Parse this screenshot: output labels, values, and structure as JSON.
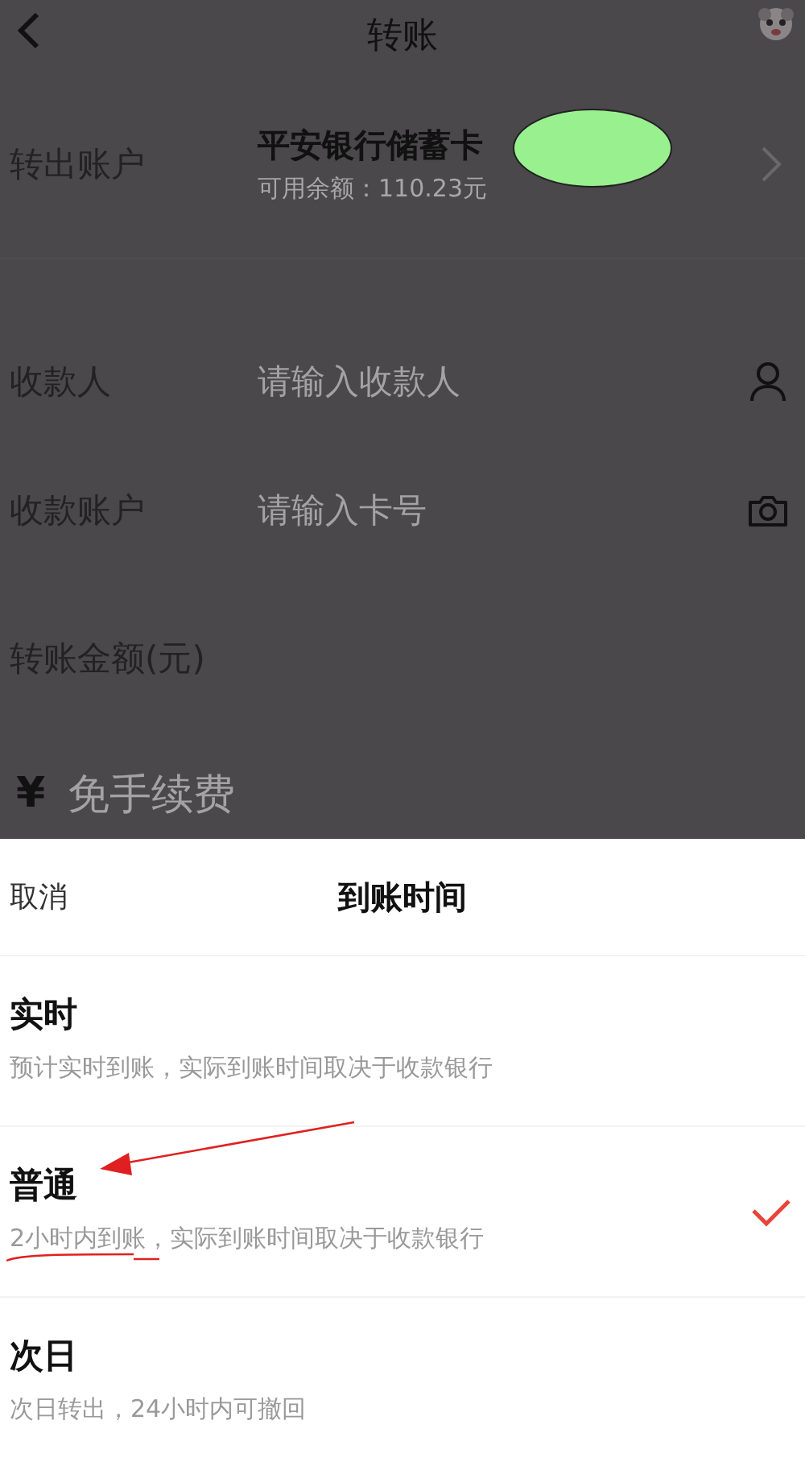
{
  "header": {
    "title": "转账"
  },
  "from_account": {
    "label": "转出账户",
    "card_name": "平安银行储蓄卡",
    "balance": "可用余额：110.23元"
  },
  "fields": [
    {
      "label": "收款人",
      "placeholder": "请输入收款人",
      "kind": "person"
    },
    {
      "label": "收款账户",
      "placeholder": "请输入卡号",
      "kind": "camera"
    }
  ],
  "amount": {
    "label": "转账金额(元)",
    "currency": "¥",
    "placeholder": "免手续费"
  },
  "sheet": {
    "cancel": "取消",
    "title": "到账时间",
    "options": [
      {
        "title": "实时",
        "description": "预计实时到账，实际到账时间取决于收款银行",
        "selected": false
      },
      {
        "title": "普通",
        "description": "2小时内到账，实际到账时间取决于收款银行",
        "selected": true
      },
      {
        "title": "次日",
        "description": "次日转出，24小时内可撤回",
        "selected": false
      }
    ]
  }
}
